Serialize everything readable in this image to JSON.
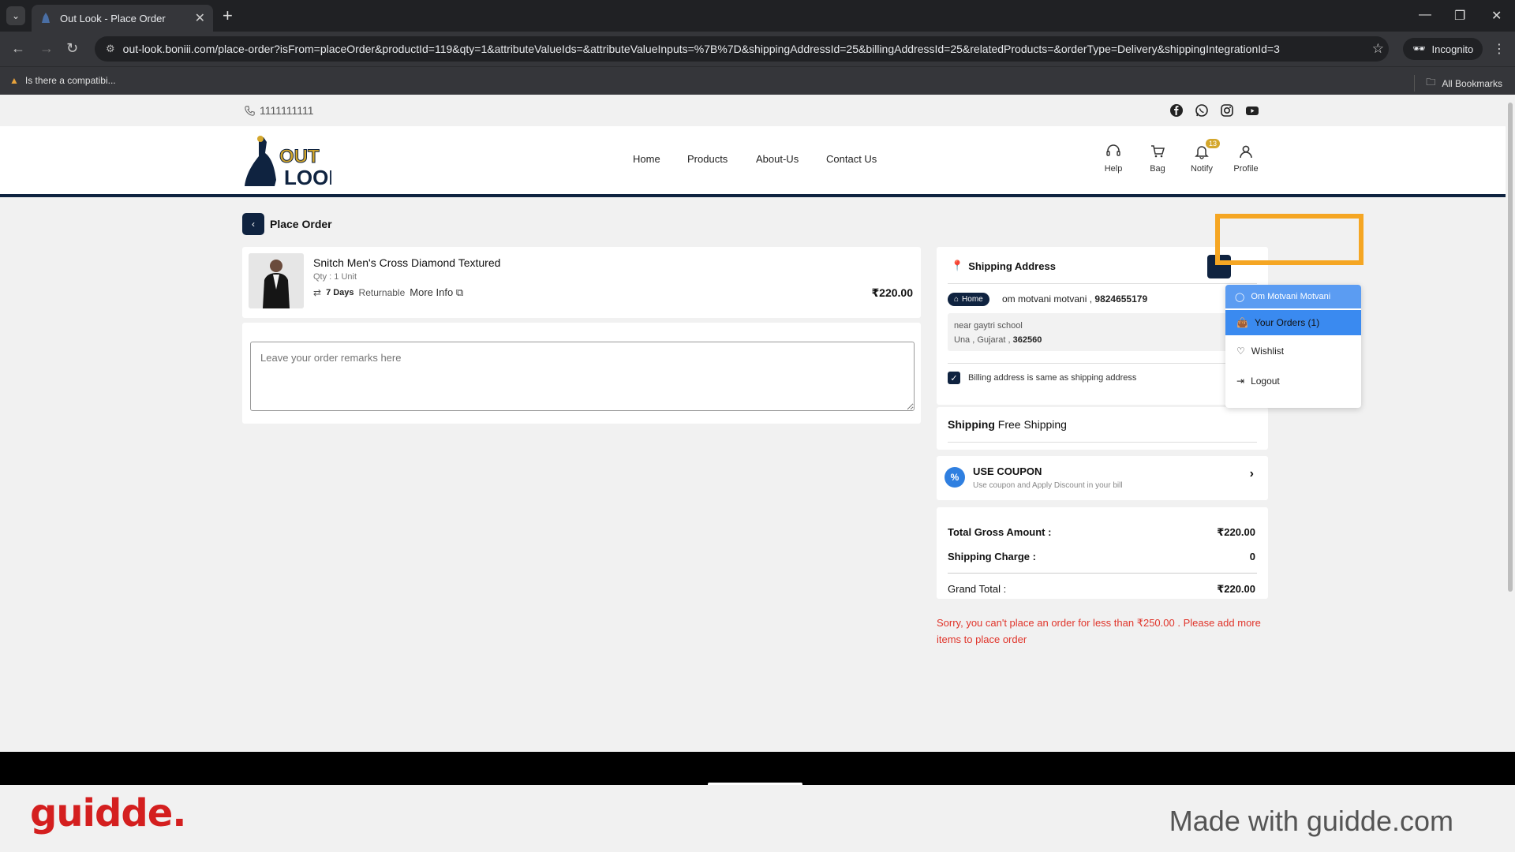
{
  "browser": {
    "tab_title": "Out Look - Place Order",
    "url": "out-look.boniii.com/place-order?isFrom=placeOrder&productId=119&qty=1&attributeValueIds=&attributeValueInputs=%7B%7D&shippingAddressId=25&billingAddressId=25&relatedProducts=&orderType=Delivery&shippingIntegrationId=3",
    "incognito_label": "Incognito",
    "bookmark": "Is there a compatibi...",
    "all_bookmarks": "All Bookmarks"
  },
  "topstrip": {
    "phone": "1111111111",
    "social_icons": [
      "facebook-icon",
      "whatsapp-icon",
      "instagram-icon",
      "youtube-icon"
    ]
  },
  "header": {
    "logo_text": "OUT LOOK",
    "nav": [
      "Home",
      "Products",
      "About-Us",
      "Contact Us"
    ],
    "icons": {
      "help": "Help",
      "bag": "Bag",
      "notify": "Notify",
      "notify_badge": "13",
      "profile": "Profile"
    }
  },
  "page": {
    "title": "Place Order",
    "product": {
      "name": "Snitch Men's Cross Diamond Textured",
      "qty": "Qty : 1 Unit",
      "return_days": "7 Days",
      "returnable": "Returnable",
      "more_info": "More Info",
      "price": "₹220.00"
    },
    "remarks_placeholder": "Leave your order remarks here",
    "shipping": {
      "title": "Shipping Address",
      "tag": "Home",
      "name": "om motvani  motvani ,",
      "phone": "9824655179",
      "address_line1": "near gaytri school",
      "address_city": "Una ,  Gujarat ,",
      "pincode": "362560",
      "billing_same": "Billing address is same as shipping address",
      "shipping_label": "Shipping",
      "shipping_value": "Free Shipping"
    },
    "coupon": {
      "title": "USE COUPON",
      "subtitle": "Use coupon and Apply Discount in your bill"
    },
    "summary": {
      "gross_label": "Total Gross Amount :",
      "gross_value": "₹220.00",
      "ship_label": "Shipping Charge :",
      "ship_value": "0",
      "grand_label": "Grand Total :",
      "grand_value": "₹220.00"
    },
    "error": "Sorry, you can't place an order for less than ₹250.00 . Please add more items to place order"
  },
  "profile_menu": {
    "user": "Om Motvani Motvani",
    "items": [
      "Your Orders (1)",
      "Wishlist",
      "Logout"
    ]
  },
  "branding": {
    "logo": "guidde.",
    "made_with": "Made with guidde.com"
  },
  "colors": {
    "navy": "#0f2340",
    "highlight": "#f5a623",
    "error": "#e0342a",
    "dropdown_active": "#3a8af0"
  }
}
